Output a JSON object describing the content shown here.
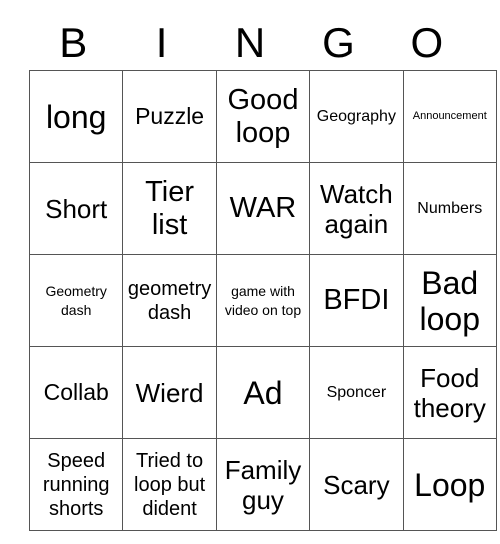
{
  "card": {
    "header_letters": [
      "B",
      "I",
      "N",
      "G",
      "O"
    ],
    "rows": [
      [
        {
          "label": "long",
          "size": "fs-32"
        },
        {
          "label": "Puzzle",
          "size": "fs-23"
        },
        {
          "label": "Good loop",
          "size": "fs-29"
        },
        {
          "label": "Geography",
          "size": "fs-16"
        },
        {
          "label": "Announcement",
          "size": "fs-11"
        }
      ],
      [
        {
          "label": "Short",
          "size": "fs-26"
        },
        {
          "label": "Tier list",
          "size": "fs-29"
        },
        {
          "label": "WAR",
          "size": "fs-29"
        },
        {
          "label": "Watch again",
          "size": "fs-26"
        },
        {
          "label": "Numbers",
          "size": "fs-16"
        }
      ],
      [
        {
          "label": "Geometry dash",
          "size": "fs-14"
        },
        {
          "label": "geometry dash",
          "size": "fs-20"
        },
        {
          "label": "game with video on top",
          "size": "fs-14"
        },
        {
          "label": "BFDI",
          "size": "fs-29"
        },
        {
          "label": "Bad loop",
          "size": "fs-32"
        }
      ],
      [
        {
          "label": "Collab",
          "size": "fs-23"
        },
        {
          "label": "Wierd",
          "size": "fs-26"
        },
        {
          "label": "Ad",
          "size": "fs-32"
        },
        {
          "label": "Sponcer",
          "size": "fs-16"
        },
        {
          "label": "Food theory",
          "size": "fs-26"
        }
      ],
      [
        {
          "label": "Speed running shorts",
          "size": "fs-20"
        },
        {
          "label": "Tried to loop but dident",
          "size": "fs-20"
        },
        {
          "label": "Family guy",
          "size": "fs-26"
        },
        {
          "label": "Scary",
          "size": "fs-26"
        },
        {
          "label": "Loop",
          "size": "fs-32"
        }
      ]
    ]
  },
  "style": {
    "grid_line_color": "#555555",
    "text_color": "#000000",
    "background_color": "#ffffff"
  }
}
